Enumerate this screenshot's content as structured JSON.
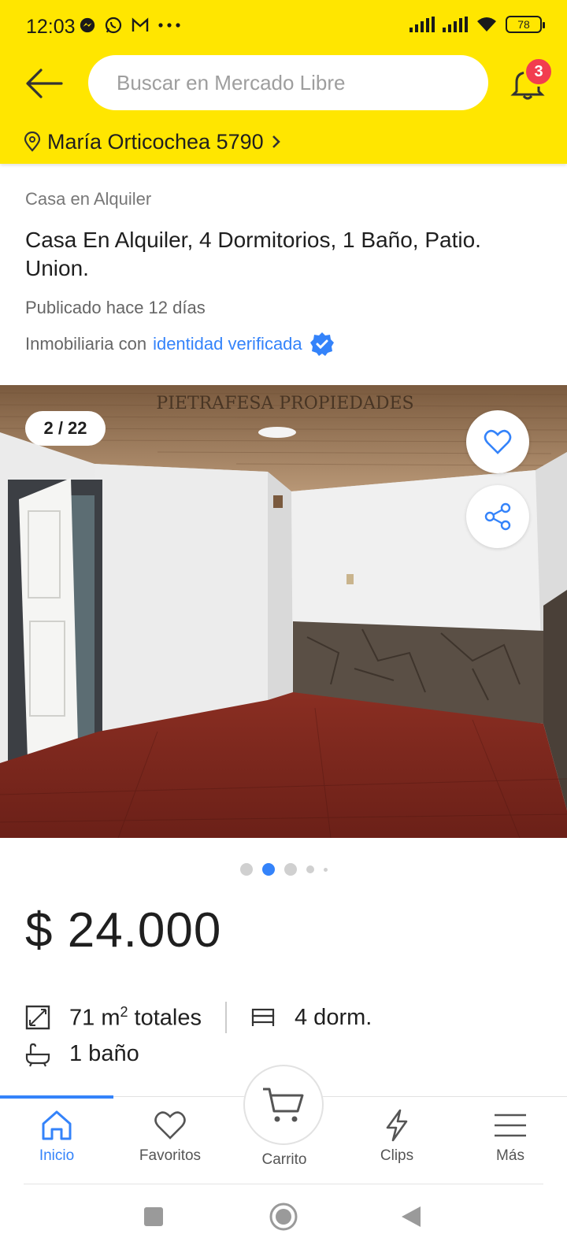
{
  "status_bar": {
    "time": "12:03",
    "battery": "78"
  },
  "header": {
    "search_placeholder": "Buscar en Mercado Libre",
    "notification_count": "3",
    "location": "María Orticochea 5790"
  },
  "listing": {
    "category": "Casa en Alquiler",
    "title": "Casa En Alquiler, 4 Dormitorios, 1 Baño, Patio. Union.",
    "published": "Publicado hace 12 días",
    "seller_prefix": "Inmobiliaria con",
    "seller_link": "identidad verificada",
    "photo_counter": "2 / 22",
    "watermark": "PIETRAFESA PROPIEDADES",
    "price": "$ 24.000",
    "area_value": "71 m",
    "area_sup": "2",
    "area_suffix": " totales",
    "bedrooms": "4 dorm.",
    "bathrooms": "1 baño",
    "carousel_active_dot": 2
  },
  "bottom_nav": {
    "items": [
      {
        "label": "Inicio",
        "icon": "home-icon"
      },
      {
        "label": "Favoritos",
        "icon": "heart-icon"
      },
      {
        "label": "Carrito",
        "icon": "cart-icon"
      },
      {
        "label": "Clips",
        "icon": "lightning-icon"
      },
      {
        "label": "Más",
        "icon": "menu-icon"
      }
    ],
    "active": "Inicio"
  },
  "colors": {
    "header_bg": "#ffe600",
    "accent": "#3483fa",
    "badge": "#f23d4f"
  }
}
